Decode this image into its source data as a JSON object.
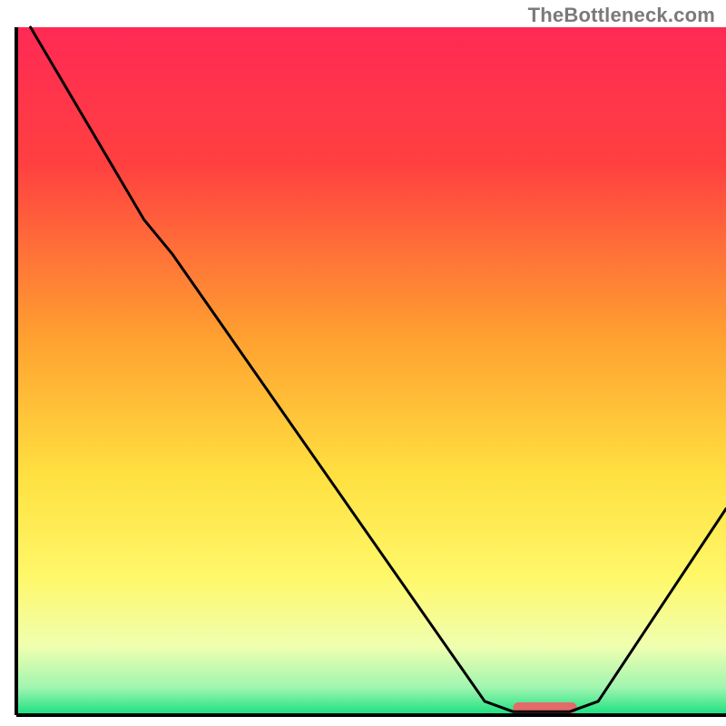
{
  "watermark": "TheBottleneck.com",
  "chart_data": {
    "type": "line",
    "title": "",
    "xlabel": "",
    "ylabel": "",
    "xlim": [
      0,
      100
    ],
    "ylim": [
      0,
      100
    ],
    "background_gradient": {
      "stops": [
        {
          "offset": 0,
          "color": "#ff2a55"
        },
        {
          "offset": 20,
          "color": "#ff4040"
        },
        {
          "offset": 45,
          "color": "#ffa030"
        },
        {
          "offset": 65,
          "color": "#ffe040"
        },
        {
          "offset": 80,
          "color": "#fff86a"
        },
        {
          "offset": 90,
          "color": "#f0ffb0"
        },
        {
          "offset": 96,
          "color": "#a0f5b0"
        },
        {
          "offset": 100,
          "color": "#18e080"
        }
      ]
    },
    "axes_color": "#000000",
    "series": [
      {
        "name": "bottleneck-curve",
        "color": "#000000",
        "points": [
          {
            "x": 2,
            "y": 100
          },
          {
            "x": 18,
            "y": 72
          },
          {
            "x": 22,
            "y": 67
          },
          {
            "x": 66,
            "y": 2
          },
          {
            "x": 70,
            "y": 0.5
          },
          {
            "x": 78,
            "y": 0.5
          },
          {
            "x": 82,
            "y": 2
          },
          {
            "x": 100,
            "y": 30
          }
        ]
      }
    ],
    "marker": {
      "name": "optimal-range-marker",
      "color": "#e46a6a",
      "x_start": 70,
      "x_end": 79,
      "y": 0,
      "thickness_pct": 1.6
    }
  }
}
